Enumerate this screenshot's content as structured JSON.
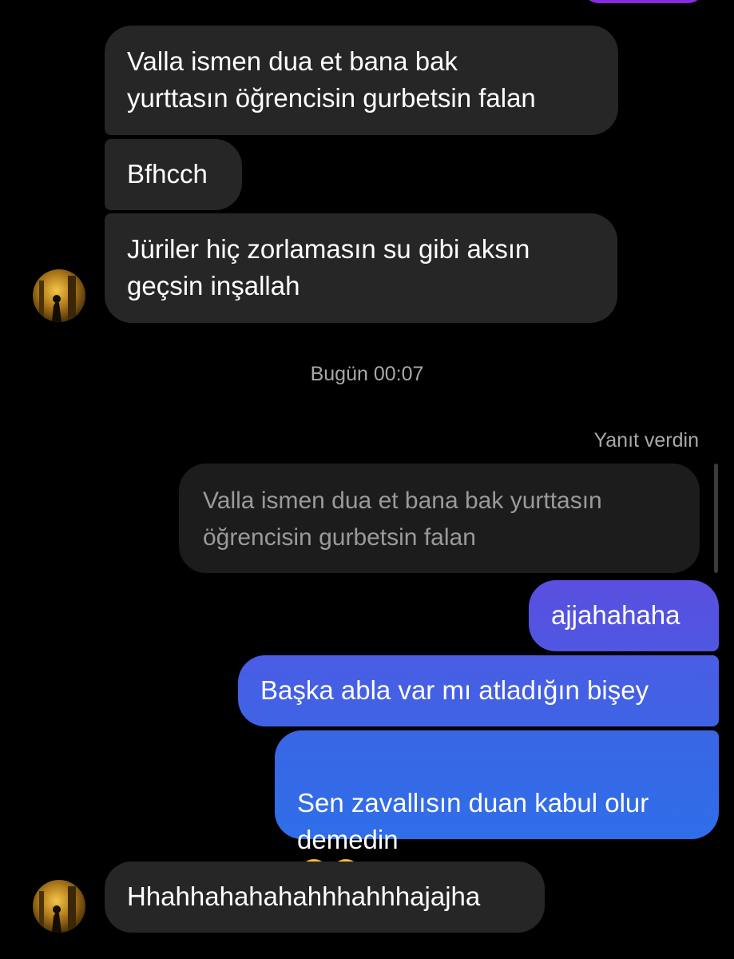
{
  "colors": {
    "background": "#000000",
    "received_bubble": "#262626",
    "quote_bubble": "#1c1c1c",
    "sent_gradient_top": "#5b4ee2",
    "sent_gradient_bottom": "#2f6ee8",
    "muted_text": "#a8a8a8"
  },
  "messages_before": [
    {
      "sender": "other",
      "text": "Valla ismen dua et bana bak\nyurttasın öğrencisin gurbetsin falan"
    },
    {
      "sender": "other",
      "text": "Bfhcch"
    },
    {
      "sender": "other",
      "text": "Jüriler hiç zorlamasın su gibi aksın\ngeçsin inşallah"
    }
  ],
  "timestamp": "Bugün 00:07",
  "reply": {
    "label": "Yanıt verdin",
    "quoted_text": "Valla ismen dua et bana bak yurttasın\nöğrencisin gurbetsin falan"
  },
  "sent_messages": [
    {
      "text": "ajjahahaha"
    },
    {
      "text": "Başka abla var mı atladığın bişey"
    },
    {
      "text": "Sen zavallısın duan kabul olur\ndemedin",
      "emoji": [
        "face-with-tears-of-joy",
        "face-with-tears-of-joy"
      ]
    }
  ],
  "last_message": {
    "sender": "other",
    "text": "Hhahhahahahahhhahhhajajha"
  },
  "avatar_icon": "profile-photo"
}
